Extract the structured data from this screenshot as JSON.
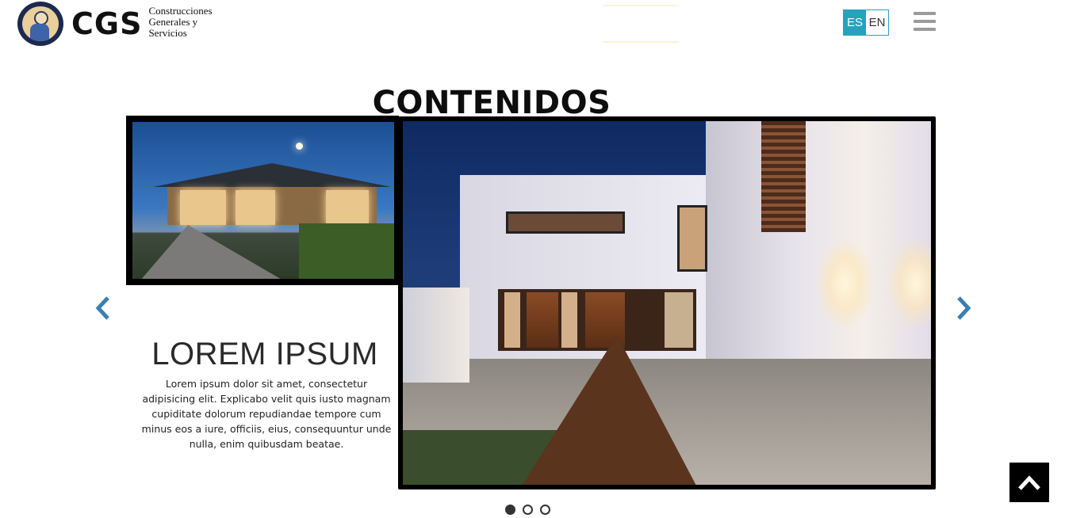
{
  "header": {
    "brand": "CGS",
    "tagline": "Construcciones Generales y Servicios",
    "languages": [
      {
        "code": "ES",
        "active": true
      },
      {
        "code": "EN",
        "active": false
      }
    ],
    "menu_icon": "hamburger-icon"
  },
  "main": {
    "section_title": "CONTENIDOS"
  },
  "carousel": {
    "prev_icon": "chevron-left-icon",
    "next_icon": "chevron-right-icon",
    "slide": {
      "heading": "LOREM IPSUM",
      "body": "Lorem ipsum dolor sit amet, consectetur adipisicing elit. Explicabo velit quis iusto magnam cupiditate dolorum repudiandae tempore cum minus eos a iure, officiis, eius, consequuntur unde nulla, enim quibusdam beatae."
    },
    "dots_total": 3,
    "dots_active_index": 0
  },
  "colors": {
    "accent": "#25a3bd",
    "arrow": "#3a7fb0",
    "menu_icon": "#9b9b9b"
  },
  "back_to_top": {
    "icon": "chevron-up-icon"
  }
}
